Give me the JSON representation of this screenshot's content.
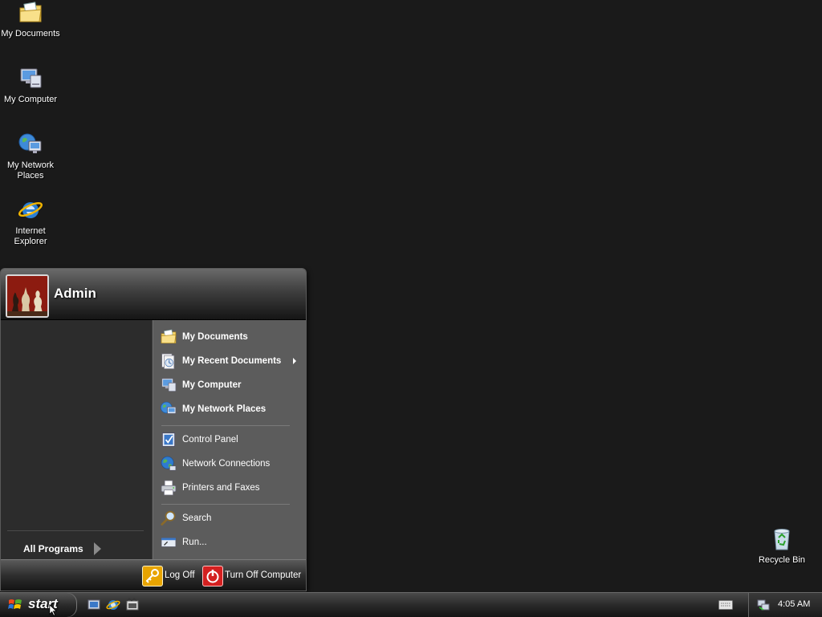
{
  "desktop": {
    "icons": [
      {
        "label": "My Documents",
        "icon": "my-documents-icon"
      },
      {
        "label": "My Computer",
        "icon": "my-computer-icon"
      },
      {
        "label": "My Network\nPlaces",
        "icon": "network-places-icon"
      },
      {
        "label": "Internet\nExplorer",
        "icon": "internet-explorer-icon"
      },
      {
        "label": "Recycle Bin",
        "icon": "recycle-bin-icon"
      }
    ]
  },
  "start_menu": {
    "username": "Admin",
    "all_programs": "All Programs",
    "right_items": [
      {
        "label": "My Documents",
        "icon": "my-documents-icon"
      },
      {
        "label": "My Recent Documents",
        "icon": "recent-documents-icon"
      },
      {
        "label": "My Computer",
        "icon": "my-computer-icon"
      },
      {
        "label": "My Network Places",
        "icon": "network-places-icon"
      },
      {
        "label": "Control Panel",
        "icon": "control-panel-icon"
      },
      {
        "label": "Network Connections",
        "icon": "network-connections-icon"
      },
      {
        "label": "Printers and Faxes",
        "icon": "printer-icon"
      },
      {
        "label": "Search",
        "icon": "search-icon"
      },
      {
        "label": "Run...",
        "icon": "run-icon"
      }
    ],
    "footer": {
      "log_off": "Log Off",
      "turn_off": "Turn Off Computer"
    }
  },
  "taskbar": {
    "start_label": "start",
    "clock": "4:05 AM"
  },
  "colors": {
    "desktop_bg": "#1a1a1a",
    "menu_right_bg": "#5c5c5c",
    "menu_left_bg": "#2c2c2c",
    "log_off_icon": "#e8a400",
    "turn_off_icon": "#d42020"
  }
}
